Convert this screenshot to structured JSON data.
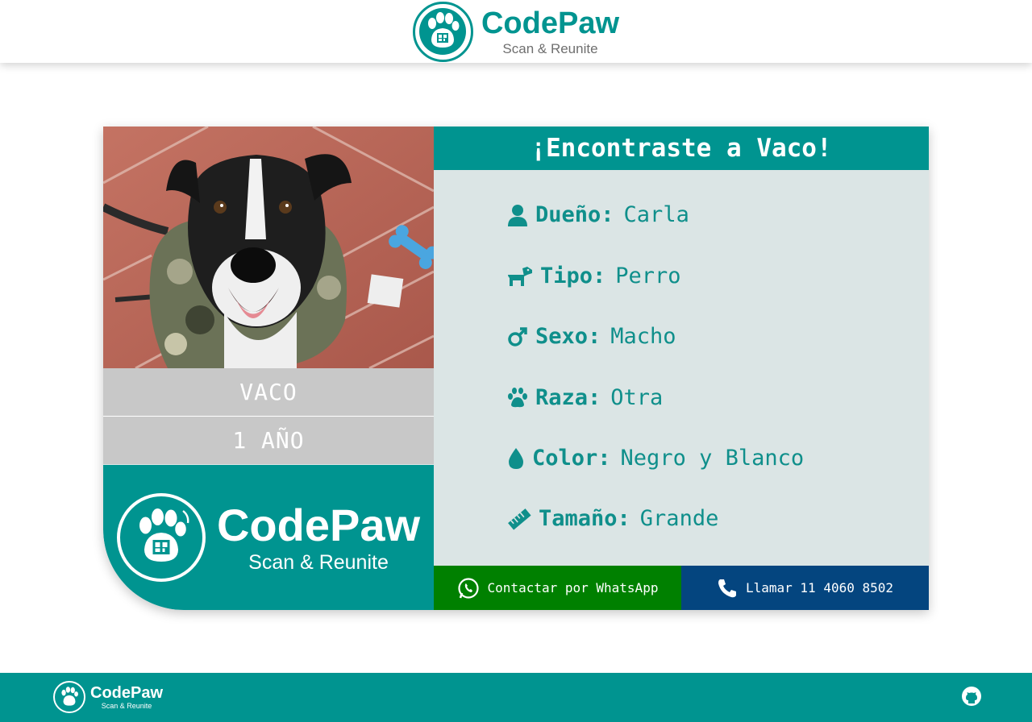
{
  "header": {
    "brand_name": "CodePaw",
    "brand_tagline": "Scan & Reunite"
  },
  "pet_card": {
    "name": "VACO",
    "age": "1 AÑO",
    "title": "¡Encontraste a Vaco!",
    "panel_brand_name": "CodePaw",
    "panel_brand_tagline": "Scan & Reunite",
    "details": [
      {
        "icon": "user-icon",
        "label": "Dueño:",
        "value": "Carla"
      },
      {
        "icon": "dog-icon",
        "label": "Tipo:",
        "value": "Perro"
      },
      {
        "icon": "male-icon",
        "label": "Sexo:",
        "value": "Macho"
      },
      {
        "icon": "paw-icon",
        "label": "Raza:",
        "value": "Otra"
      },
      {
        "icon": "droplet-icon",
        "label": "Color:",
        "value": "Negro y Blanco"
      },
      {
        "icon": "ruler-icon",
        "label": "Tamaño:",
        "value": "Grande"
      }
    ],
    "whatsapp_label": "Contactar por WhatsApp",
    "call_label": "Llamar 11 4060 8502"
  },
  "footer": {
    "brand_name": "CodePaw",
    "brand_tagline": "Scan & Reunite"
  },
  "colors": {
    "teal": "#009490",
    "teal_text": "#0f8f8b",
    "whatsapp_green": "#008000",
    "call_blue": "#04457f",
    "panel_bg": "#dbe5e5",
    "name_box_gray": "#c8c8c8"
  }
}
